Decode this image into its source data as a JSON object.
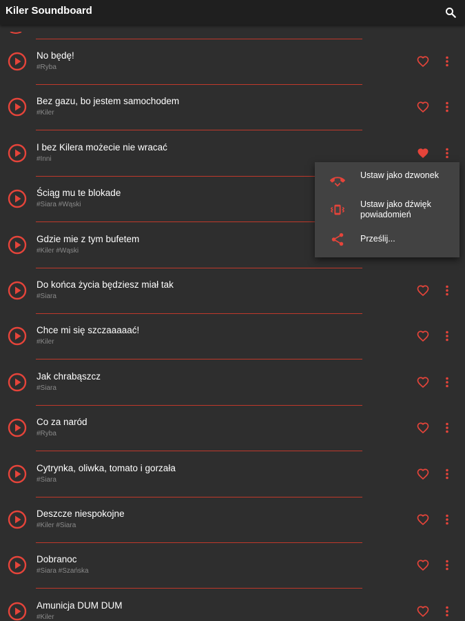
{
  "app": {
    "title": "Kiler Soundboard",
    "search_icon": "search-icon"
  },
  "colors": {
    "accent": "#e5443a",
    "divider": "#c1392b",
    "background": "#2e2e2e",
    "appbar": "#1f1f1f",
    "menu": "#424242"
  },
  "sounds": [
    {
      "title": "No będę!",
      "tags": "#Ryba",
      "favorite": false
    },
    {
      "title": "Bez gazu, bo jestem samochodem",
      "tags": "#Kiler",
      "favorite": false
    },
    {
      "title": "I bez Kilera możecie nie wracać",
      "tags": "#Inni",
      "favorite": true
    },
    {
      "title": "Ściąg mu te blokade",
      "tags": "#Siara #Wąski",
      "favorite": false
    },
    {
      "title": "Gdzie mie z tym bufetem",
      "tags": "#Kiler #Wąski",
      "favorite": false
    },
    {
      "title": "Do końca życia będziesz miał tak",
      "tags": "#Siara",
      "favorite": false
    },
    {
      "title": "Chce mi się szczaaaaać!",
      "tags": "#Kiler",
      "favorite": false
    },
    {
      "title": "Jak chrabąszcz",
      "tags": "#Siara",
      "favorite": false
    },
    {
      "title": "Co za naród",
      "tags": "#Ryba",
      "favorite": false
    },
    {
      "title": "Cytrynka, oliwka, tomato i gorzała",
      "tags": "#Siara",
      "favorite": false
    },
    {
      "title": "Deszcze niespokojne",
      "tags": "#Kiler #Siara",
      "favorite": false
    },
    {
      "title": "Dobranoc",
      "tags": "#Siara #Szańska",
      "favorite": false
    },
    {
      "title": "Amunicja DUM DUM",
      "tags": "#Kiler",
      "favorite": false
    }
  ],
  "context_menu": {
    "items": [
      {
        "label": "Ustaw jako dzwonek",
        "icon": "ringtone-icon"
      },
      {
        "label": "Ustaw jako dźwięk powiadomień",
        "icon": "notification-vibrate-icon"
      },
      {
        "label": "Prześlij...",
        "icon": "share-icon"
      }
    ]
  }
}
